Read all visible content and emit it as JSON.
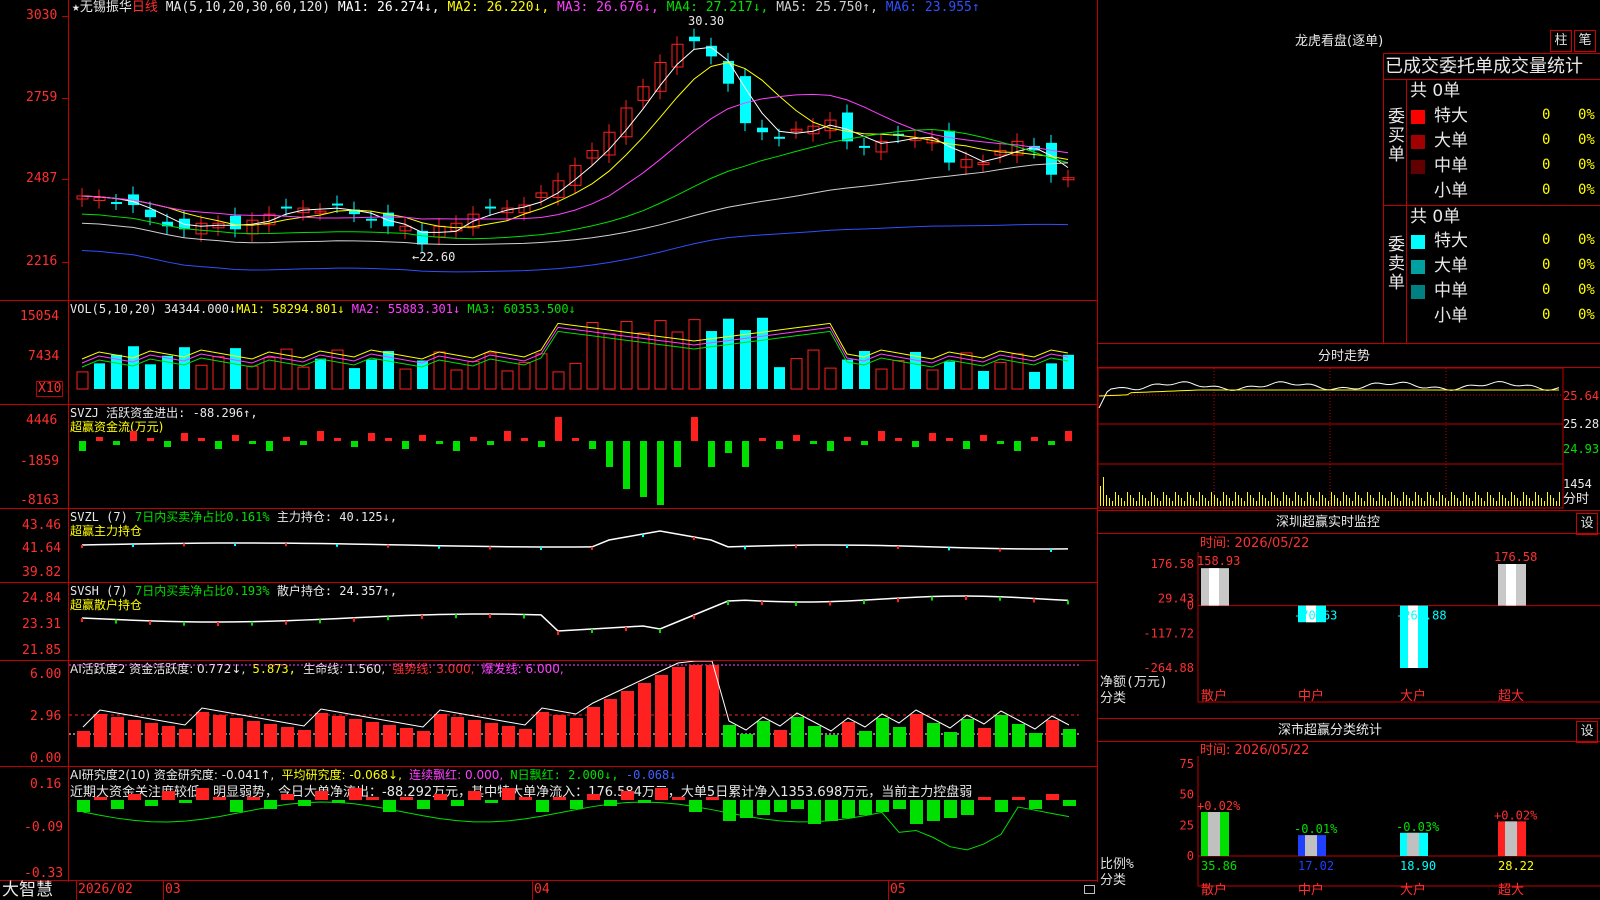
{
  "app_name": "大智慧",
  "colors": {
    "up": "#ff2020",
    "down": "#00ffff",
    "bg": "#000000",
    "grid": "#b00000"
  },
  "main": {
    "star": "★",
    "stock_name": "无锡振华",
    "period": "日线",
    "ma_label": "MA(5,10,20,30,60,120)",
    "ma": [
      {
        "label": "MA1: 26.274↓",
        "color": "#ffffff"
      },
      {
        "label": "MA2: 26.220↓",
        "color": "#ffff00"
      },
      {
        "label": "MA3: 26.676↓",
        "color": "#ff40ff"
      },
      {
        "label": "MA4: 27.217↓",
        "color": "#00e000"
      },
      {
        "label": "MA5: 25.750↑",
        "color": "#d0d0d0"
      },
      {
        "label": "MA6: 23.955↑",
        "color": "#3050ff"
      }
    ],
    "y_ticks": [
      "3030",
      "2759",
      "2487",
      "2216"
    ],
    "high_label": "30.30",
    "low_label": "←22.60"
  },
  "vol": {
    "title": "VOL(5,10,20)",
    "value": "34344.000↓",
    "ma1": "MA1: 58294.801↓",
    "ma2": "MA2: 55883.301↓",
    "ma3": "MA3: 60353.500↓",
    "y_ticks": [
      "15054",
      "7434"
    ],
    "unit": "X10"
  },
  "svzj": {
    "title": "SVZJ  活跃资金进出: -88.296↑,",
    "subtitle": "超赢资金流(万元)",
    "y_ticks": [
      "4446",
      "-1859",
      "-8163"
    ]
  },
  "svzl": {
    "title_a": "SVZL (7)",
    "title_b": "7日内买卖净占比0.161%",
    "title_c": "主力持仓: 40.125↓,",
    "subtitle": "超赢主力持仓",
    "y_ticks": [
      "43.46",
      "41.64",
      "39.82"
    ]
  },
  "svsh": {
    "title_a": "SVSH (7)",
    "title_b": "7日内买卖净占比0.193%",
    "title_c": "散户持仓: 24.357↑,",
    "subtitle": "超赢散户持仓",
    "y_ticks": [
      "24.84",
      "23.31",
      "21.85"
    ]
  },
  "ai1": {
    "title": "AI活跃度2 资金活跃度: 0.772↓,",
    "v2": "5.873,",
    "v3": "生命线: 1.560,",
    "v4": "强势线: 3.000,",
    "v5": "爆发线: 6.000,",
    "y_ticks": [
      "6.00",
      "2.96",
      "0.00"
    ]
  },
  "ai2": {
    "title": "AI研究度2(10) 资金研究度: -0.041↑,",
    "v2": "平均研究度: -0.068↓,",
    "v3": "连续飘红: 0.000,",
    "v4": "N日飘红: 2.000↓,",
    "v5": "-0.068↓",
    "comment": "近期大资金关注度较低，明显弱势，今日大单净流出：-88.292万元，其中特大单净流入：176.584万元，大单5日累计净入1353.698万元，当前主力控盘弱",
    "y_ticks": [
      "0.16",
      "-0.09",
      "-0.33"
    ]
  },
  "xaxis": {
    "labels": [
      "2026/02",
      "03",
      "04",
      "05"
    ]
  },
  "dragon": {
    "title": "龙虎看盘(逐单)",
    "btn_bar": "柱",
    "btn_pen": "笔",
    "header": "已成交委托单成交量统计",
    "buy_label": "委买单",
    "sell_label": "委卖单",
    "buy_total": "共 0单",
    "sell_total": "共 0单",
    "rows_buy": [
      {
        "name": "特大",
        "count": "0",
        "pct": "0%",
        "color": "#ff0000"
      },
      {
        "name": "大单",
        "count": "0",
        "pct": "0%",
        "color": "#a00000"
      },
      {
        "name": "中单",
        "count": "0",
        "pct": "0%",
        "color": "#600000"
      },
      {
        "name": "小单",
        "count": "0",
        "pct": "0%",
        "color": ""
      }
    ],
    "rows_sell": [
      {
        "name": "特大",
        "count": "0",
        "pct": "0%",
        "color": "#00ffff"
      },
      {
        "name": "大单",
        "count": "0",
        "pct": "0%",
        "color": "#00a0a0"
      },
      {
        "name": "中单",
        "count": "0",
        "pct": "0%",
        "color": "#008080"
      },
      {
        "name": "小单",
        "count": "0",
        "pct": "0%",
        "color": ""
      }
    ]
  },
  "intraday": {
    "title": "分时走势",
    "y_ticks": [
      "25.64",
      "25.28",
      "24.93"
    ],
    "vol_label": "1454",
    "vol_unit": "分时"
  },
  "sz_monitor": {
    "title": "深圳超赢实时监控",
    "btn": "设",
    "time": "时间: 2026/05/22",
    "y_ticks": [
      "176.58",
      "29.43",
      "0",
      "-117.72",
      "-264.88"
    ],
    "axis_label": "净额(万元)",
    "cat_label": "分类",
    "categories": [
      "散户",
      "中户",
      "大户",
      "超大"
    ],
    "values": [
      "158.93",
      "-70.63",
      "-264.88",
      "176.58"
    ]
  },
  "sz_class": {
    "title": "深市超赢分类统计",
    "btn": "设",
    "time": "时间: 2026/05/22",
    "y_ticks": [
      "75",
      "50",
      "25",
      "0"
    ],
    "axis_label": "比例%",
    "cat_label": "分类",
    "categories": [
      "散户",
      "中户",
      "大户",
      "超大"
    ],
    "changes": [
      "+0.02%",
      "-0.01%",
      "-0.03%",
      "+0.02%"
    ],
    "values": [
      "35.86",
      "17.02",
      "18.90",
      "28.22"
    ]
  },
  "chart_data": [
    {
      "type": "bar",
      "title": "深圳超赢实时监控",
      "ylabel": "净额(万元)",
      "categories": [
        "散户",
        "中户",
        "大户",
        "超大"
      ],
      "values": [
        158.93,
        -70.63,
        -264.88,
        176.58
      ],
      "ylim": [
        -264.88,
        176.58
      ]
    },
    {
      "type": "bar",
      "title": "深市超赢分类统计",
      "ylabel": "比例%",
      "categories": [
        "散户",
        "中户",
        "大户",
        "超大"
      ],
      "values": [
        35.86,
        17.02,
        18.9,
        28.22
      ],
      "ylim": [
        0,
        75
      ]
    }
  ]
}
